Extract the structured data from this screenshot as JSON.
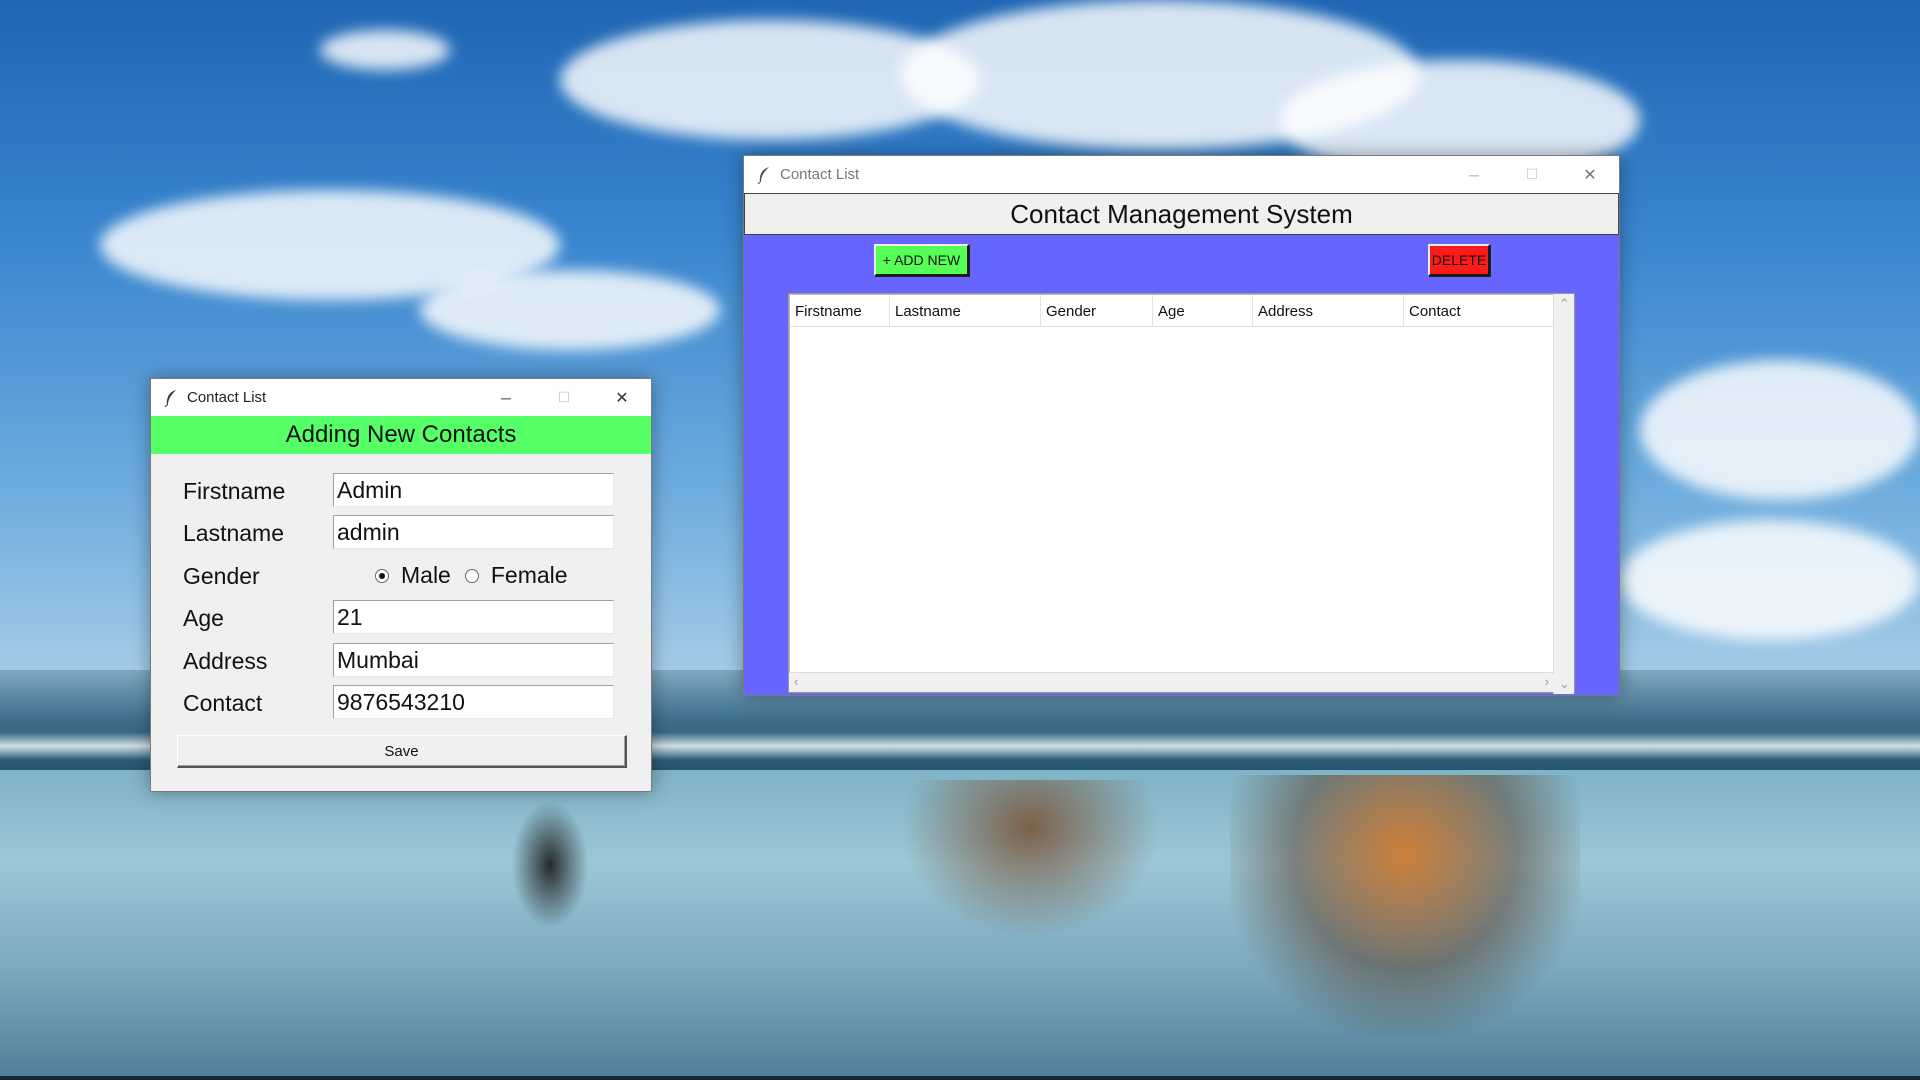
{
  "main_window": {
    "title": "Contact List",
    "header": "Contact Management System",
    "add_button": "+ ADD NEW",
    "delete_button": "DELETE",
    "columns": [
      "Firstname",
      "Lastname",
      "Gender",
      "Age",
      "Address",
      "Contact"
    ],
    "rows": []
  },
  "add_window": {
    "title": "Contact List",
    "header": "Adding New Contacts",
    "fields": {
      "firstname": {
        "label": "Firstname",
        "value": "Admin"
      },
      "lastname": {
        "label": "Lastname",
        "value": "admin"
      },
      "gender": {
        "label": "Gender",
        "options": [
          "Male",
          "Female"
        ],
        "selected": "Male"
      },
      "age": {
        "label": "Age",
        "value": "21"
      },
      "address": {
        "label": "Address",
        "value": "Mumbai"
      },
      "contact": {
        "label": "Contact",
        "value": "9876543210"
      }
    },
    "save_button": "Save"
  },
  "window_controls": {
    "minimize": "─",
    "maximize": "☐",
    "close": "✕"
  },
  "colors": {
    "main_body": "#6666ff",
    "add_header": "#55ff66",
    "add_button": "#55ff55",
    "delete_button": "#ff1a1a"
  },
  "icons": {
    "app_icon": "feather-icon"
  }
}
